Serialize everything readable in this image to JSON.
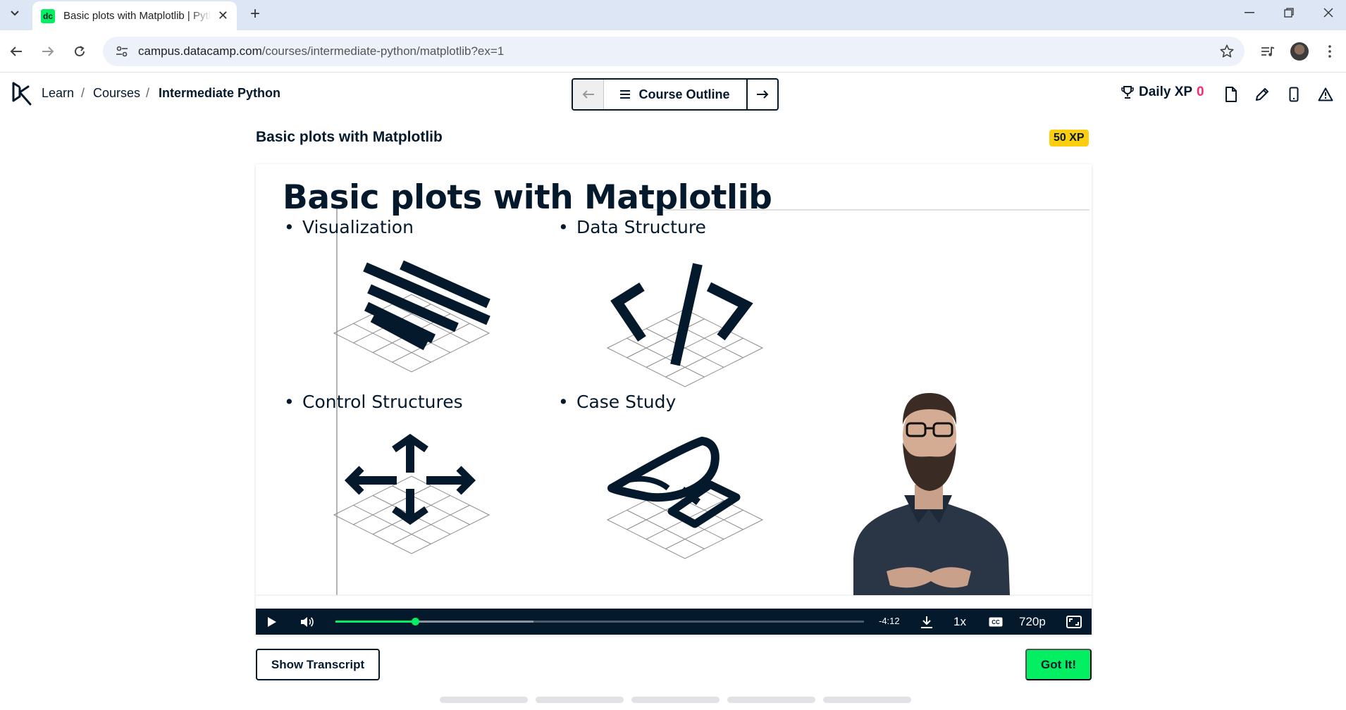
{
  "browser": {
    "tab_title": "Basic plots with Matplotlib | Python",
    "tab_favicon": "dc",
    "url_host": "campus.datacamp.com",
    "url_path": "/courses/intermediate-python/matplotlib?ex=1"
  },
  "header": {
    "breadcrumbs": [
      "Learn",
      "Courses",
      "Intermediate Python"
    ],
    "separator": "/",
    "course_outline_label": "Course Outline",
    "daily_xp_label": "Daily XP",
    "daily_xp_value": "0"
  },
  "lesson": {
    "title": "Basic plots with Matplotlib",
    "xp_badge": "50 XP"
  },
  "slide": {
    "heading": "Basic plots with Matplotlib",
    "bullets": [
      "Visualization",
      "Data Structure",
      "Control Structures",
      "Case Study"
    ]
  },
  "player": {
    "time_remaining": "-4:12",
    "speed": "1x",
    "quality": "720p",
    "played_fraction": 0.15,
    "buffered_fraction": 0.375
  },
  "actions": {
    "show_transcript": "Show Transcript",
    "got_it": "Got It!"
  },
  "colors": {
    "brand_green": "#03ef62",
    "navy": "#05192d",
    "xp_yellow": "#fcce0d",
    "xp_pink": "#ff2a6d"
  }
}
